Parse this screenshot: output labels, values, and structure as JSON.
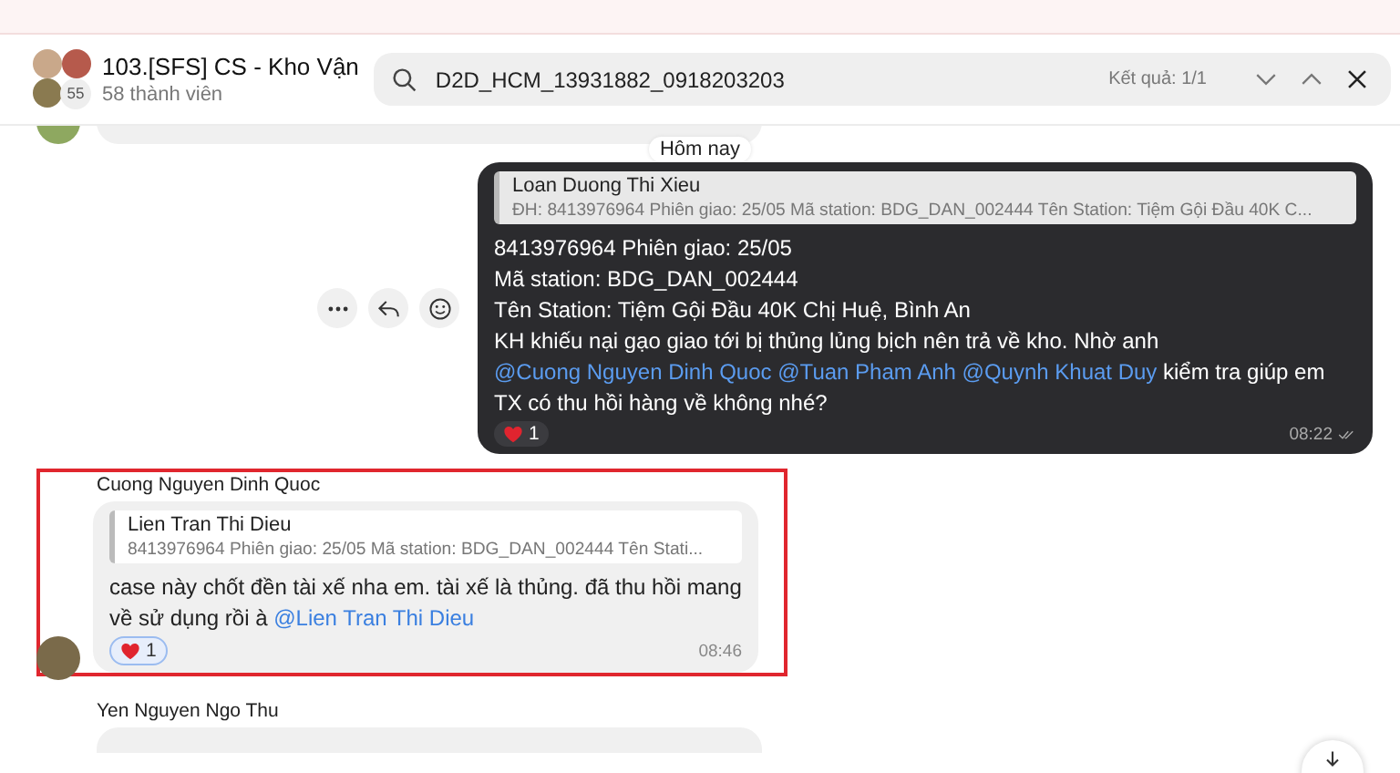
{
  "header": {
    "group_name": "103.[SFS] CS - Kho Vận",
    "member_count": "58 thành viên",
    "avatar_badge": "55"
  },
  "search": {
    "value": "D2D_HCM_13931882_0918203203",
    "result_count": "Kết quả: 1/1"
  },
  "date_divider": "Hôm nay",
  "messages": [
    {
      "kind": "outgoing",
      "show_actions": true,
      "highlighted": false,
      "quote": {
        "author": "Loan Duong Thi Xieu",
        "text": "ĐH: 8413976964 Phiên giao: 25/05 Mã station: BDG_DAN_002444 Tên Station: Tiệm Gội Đầu 40K C..."
      },
      "body": [
        [
          {
            "kind": "text",
            "text": "8413976964 Phiên giao: 25/05"
          }
        ],
        [
          {
            "kind": "text",
            "text": "Mã station: BDG_DAN_002444"
          }
        ],
        [
          {
            "kind": "text",
            "text": "Tên Station: Tiệm Gội Đầu 40K Chị Huệ, Bình An"
          }
        ],
        [
          {
            "kind": "text",
            "text": "KH khiếu nại gạo giao tới bị thủng lủng bịch nên trả về kho. Nhờ anh"
          },
          {
            "kind": "mention",
            "text": "@Cuong Nguyen Dinh Quoc"
          },
          {
            "kind": "mention",
            "text": "@Tuan Pham Anh"
          },
          {
            "kind": "mention",
            "text": "@Quynh Khuat Duy"
          },
          {
            "kind": "text",
            "text": "kiểm tra giúp em TX có thu hồi hàng về không nhé?"
          }
        ]
      ],
      "reaction_count": "1",
      "time": "08:22"
    },
    {
      "kind": "incoming",
      "sender": "Cuong Nguyen Dinh Quoc",
      "highlighted": true,
      "quote": {
        "author": "Lien Tran Thi Dieu",
        "text": "8413976964 Phiên giao: 25/05 Mã station: BDG_DAN_002444 Tên Stati..."
      },
      "body": [
        [
          {
            "kind": "text",
            "text": "case này chốt đền tài xế nha em. tài xế là thủng. đã thu hồi mang về sử dụng rồi à"
          },
          {
            "kind": "mention",
            "text": "@Lien Tran Thi Dieu"
          }
        ]
      ],
      "reaction_count": "1",
      "time": "08:46"
    },
    {
      "kind": "incoming",
      "sender": "Yen Nguyen Ngo Thu",
      "highlighted": false
    }
  ]
}
